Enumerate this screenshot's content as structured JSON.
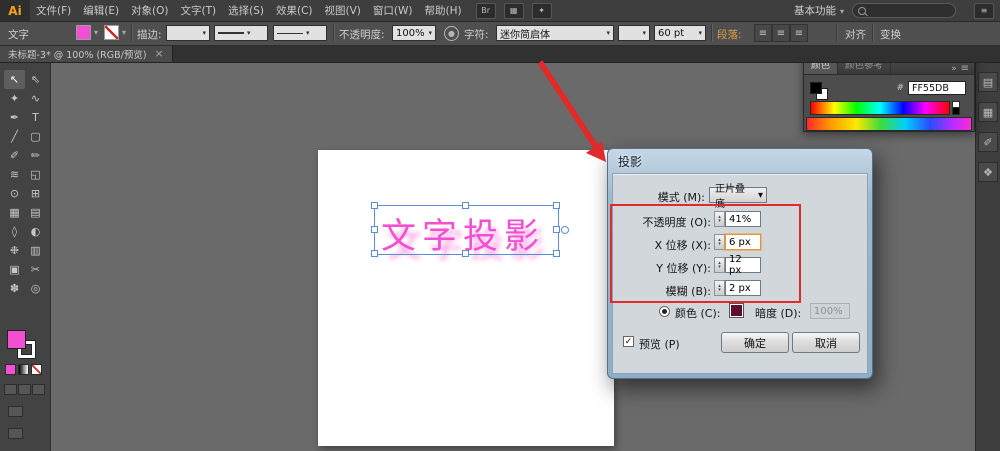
{
  "menubar": {
    "logo": "Ai",
    "items": [
      "文件(F)",
      "编辑(E)",
      "对象(O)",
      "文字(T)",
      "选择(S)",
      "效果(C)",
      "视图(V)",
      "窗口(W)",
      "帮助(H)"
    ],
    "icons": [
      {
        "g": "Br"
      },
      {
        "g": "▦"
      },
      {
        "g": "✦"
      },
      {
        "g": "≡"
      }
    ],
    "workspace_label": "基本功能",
    "search_placeholder": ""
  },
  "controlbar": {
    "context_label": "文字",
    "stroke_label": "描边:",
    "opacity_label": "不透明度:",
    "opacity_value": "100%",
    "character_label": "字符:",
    "font_value": "迷你简启体",
    "size_value": "60 pt",
    "paragraph_label": "段落:",
    "align_icons": [
      "≡",
      "≡",
      "≡"
    ],
    "align_label": "对齐",
    "transform_label": "变换"
  },
  "tabbar": {
    "title": "未标题-3* @ 100% (RGB/预览)",
    "close_glyph": "×"
  },
  "toolbar": {
    "tools": [
      {
        "n": "selection",
        "g": "↖"
      },
      {
        "n": "direct-selection",
        "g": "⇖"
      },
      {
        "n": "magic-wand",
        "g": "✦"
      },
      {
        "n": "lasso",
        "g": "∿"
      },
      {
        "n": "pen",
        "g": "✒"
      },
      {
        "n": "type",
        "g": "T"
      },
      {
        "n": "line-segment",
        "g": "╱"
      },
      {
        "n": "rectangle",
        "g": "▢"
      },
      {
        "n": "paintbrush",
        "g": "✐"
      },
      {
        "n": "pencil",
        "g": "✏"
      },
      {
        "n": "width",
        "g": "≋"
      },
      {
        "n": "free-transform",
        "g": "◱"
      },
      {
        "n": "shape-builder",
        "g": "⊙"
      },
      {
        "n": "perspective-grid",
        "g": "⊞"
      },
      {
        "n": "mesh",
        "g": "▦"
      },
      {
        "n": "gradient",
        "g": "▤"
      },
      {
        "n": "eyedropper",
        "g": "◊"
      },
      {
        "n": "blend",
        "g": "◐"
      },
      {
        "n": "symbol-sprayer",
        "g": "❉"
      },
      {
        "n": "column-graph",
        "g": "▥"
      },
      {
        "n": "artboard",
        "g": "▣"
      },
      {
        "n": "slice",
        "g": "✂"
      },
      {
        "n": "hand",
        "g": "✽"
      },
      {
        "n": "zoom",
        "g": "◎"
      }
    ]
  },
  "canvas": {
    "text": "文字投影"
  },
  "dialog": {
    "title": "投影",
    "mode_label": "模式 (M):",
    "mode_value": "正片叠底",
    "opacity_label": "不透明度 (O):",
    "opacity_value": "41%",
    "x_label": "X 位移 (X):",
    "x_value": "6 px",
    "y_label": "Y 位移 (Y):",
    "y_value": "12 px",
    "blur_label": "模糊 (B):",
    "blur_value": "2 px",
    "color_label": "颜色 (C):",
    "darkness_label": "暗度 (D):",
    "darkness_value": "100%",
    "preview_label": "预览 (P)",
    "ok_label": "确定",
    "cancel_label": "取消"
  },
  "color_panel": {
    "tab_color": "颜色",
    "tab_guide": "颜色参考",
    "collapse_glyph": "»",
    "menu_glyph": "≡",
    "hex_prefix": "#",
    "hex_value": "FF55DB"
  },
  "dock": {
    "icons": [
      {
        "g": "▤"
      },
      {
        "g": "▦"
      },
      {
        "g": "✐"
      },
      {
        "g": "❖"
      }
    ]
  },
  "colors": {
    "accent_pink": "#f24fd3",
    "shadow_pink": "#f9a0e2",
    "annotation_red": "#e12a2a",
    "dialog_shadow_swatch": "#5f0e33"
  }
}
